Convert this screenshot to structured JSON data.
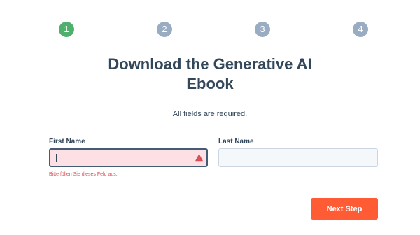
{
  "stepper": {
    "steps": [
      {
        "label": "1",
        "state": "active"
      },
      {
        "label": "2",
        "state": "inactive"
      },
      {
        "label": "3",
        "state": "inactive"
      },
      {
        "label": "4",
        "state": "inactive"
      }
    ],
    "colors": {
      "active": "#4fb06d",
      "inactive": "#99acc2",
      "line": "#dfe3eb"
    }
  },
  "form": {
    "title_line1": "Download the Generative AI",
    "title_line2": "Ebook",
    "required_note": "All fields are required.",
    "first_name": {
      "label": "First Name",
      "value": "",
      "state": "error",
      "icon": "warning-icon",
      "error_message": "Bitte füllen Sie dieses Feld aus."
    },
    "last_name": {
      "label": "Last Name",
      "value": ""
    },
    "next_button": {
      "label": "Next Step",
      "color": "#ff5c35"
    }
  }
}
